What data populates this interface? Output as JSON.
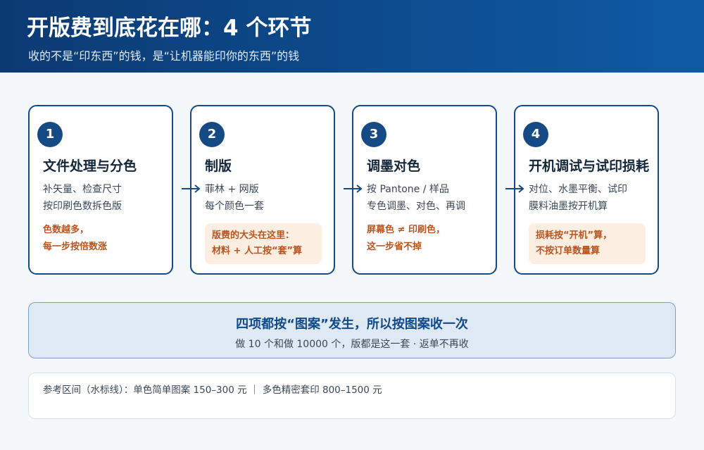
{
  "header": {
    "title": "开版费到底花在哪：4 个环节",
    "subtitle": "收的不是“印东西”的钱，是“让机器能印你的东西”的钱"
  },
  "steps": [
    {
      "number": "1",
      "title": "文件处理与分色",
      "desc": [
        "补矢量、检查尺寸",
        "按印刷色数拆色版"
      ],
      "note": [
        "色数越多，",
        "每一步按倍数涨"
      ],
      "note_style": "plain"
    },
    {
      "number": "2",
      "title": "制版",
      "desc": [
        "菲林 + 网版",
        "每个颜色一套"
      ],
      "note": [
        "版费的大头在这里：",
        "材料 + 人工按“套”算"
      ],
      "note_style": "box"
    },
    {
      "number": "3",
      "title": "调墨对色",
      "desc": [
        "按 Pantone / 样品",
        "专色调墨、对色、再调"
      ],
      "note": [
        "屏幕色 ≠ 印刷色，",
        "这一步省不掉"
      ],
      "note_style": "plain"
    },
    {
      "number": "4",
      "title": "开机调试与试印损耗",
      "desc": [
        "对位、水墨平衡、试印",
        "膜料油墨按开机算"
      ],
      "note": [
        "损耗按“开机”算，",
        "不按订单数量算"
      ],
      "note_style": "box"
    }
  ],
  "summary": {
    "main": "四项都按“图案”发生，所以按图案收一次",
    "sub": "做 10 个和做 10000 个，版都是这一套 · 返单不再收"
  },
  "reference": {
    "text": "参考区间（水标线）：单色简单图案 150–300 元  ｜  多色精密套印 800–1500 元"
  },
  "colors": {
    "header_start": "#0b3a72",
    "header_end": "#0f5aa5",
    "card_border": "#164a85",
    "note_text": "#b85420",
    "note_bg": "#fdeee2",
    "summary_bg": "#dfe9f4",
    "summary_text": "#0f4a8a"
  }
}
